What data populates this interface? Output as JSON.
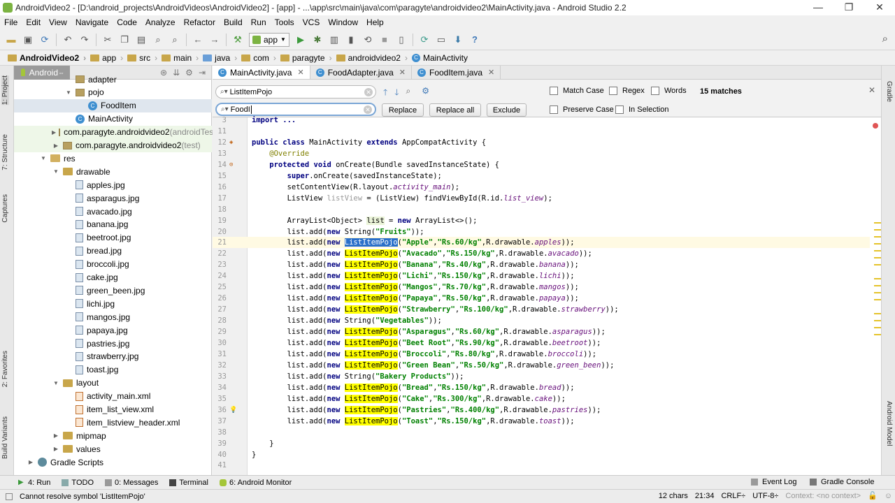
{
  "window": {
    "title": "AndroidVideo2 - [D:\\android_projects\\AndroidVideos\\AndroidVideo2] - [app] - ...\\app\\src\\main\\java\\com\\paragyte\\androidvideo2\\MainActivity.java - Android Studio 2.2",
    "controls": [
      "—",
      "❐",
      "✕"
    ]
  },
  "menu": [
    "File",
    "Edit",
    "View",
    "Navigate",
    "Code",
    "Analyze",
    "Refactor",
    "Build",
    "Run",
    "Tools",
    "VCS",
    "Window",
    "Help"
  ],
  "toolbar": {
    "run_config": "app"
  },
  "breadcrumb": [
    "AndroidVideo2",
    "app",
    "src",
    "main",
    "java",
    "com",
    "paragyte",
    "androidvideo2",
    "MainActivity"
  ],
  "project": {
    "view": "Android",
    "tree": [
      {
        "label": "adapter",
        "indent": 2,
        "icon": "pkg",
        "tw": "",
        "cut": true
      },
      {
        "label": "pojo",
        "indent": 2,
        "icon": "pkg",
        "tw": "▼"
      },
      {
        "label": "FoodItem",
        "indent": 3,
        "icon": "class",
        "tw": "",
        "selected": true
      },
      {
        "label": "MainActivity",
        "indent": 2,
        "icon": "class",
        "tw": ""
      },
      {
        "label": "com.paragyte.androidvideo2",
        "suffix": " (androidTest)",
        "indent": 1,
        "icon": "pkg",
        "tw": "▶",
        "green": true
      },
      {
        "label": "com.paragyte.androidvideo2",
        "suffix": " (test)",
        "indent": 1,
        "icon": "pkg",
        "tw": "▶",
        "green": true
      },
      {
        "label": "res",
        "indent": 0,
        "icon": "res",
        "tw": "▼"
      },
      {
        "label": "drawable",
        "indent": 1,
        "icon": "folder",
        "tw": "▼"
      },
      {
        "label": "apples.jpg",
        "indent": 2,
        "icon": "img",
        "tw": ""
      },
      {
        "label": "asparagus.jpg",
        "indent": 2,
        "icon": "img",
        "tw": ""
      },
      {
        "label": "avacado.jpg",
        "indent": 2,
        "icon": "img",
        "tw": ""
      },
      {
        "label": "banana.jpg",
        "indent": 2,
        "icon": "img",
        "tw": ""
      },
      {
        "label": "beetroot.jpg",
        "indent": 2,
        "icon": "img",
        "tw": ""
      },
      {
        "label": "bread.jpg",
        "indent": 2,
        "icon": "img",
        "tw": ""
      },
      {
        "label": "broccoli.jpg",
        "indent": 2,
        "icon": "img",
        "tw": ""
      },
      {
        "label": "cake.jpg",
        "indent": 2,
        "icon": "img",
        "tw": ""
      },
      {
        "label": "green_been.jpg",
        "indent": 2,
        "icon": "img",
        "tw": ""
      },
      {
        "label": "lichi.jpg",
        "indent": 2,
        "icon": "img",
        "tw": ""
      },
      {
        "label": "mangos.jpg",
        "indent": 2,
        "icon": "img",
        "tw": ""
      },
      {
        "label": "papaya.jpg",
        "indent": 2,
        "icon": "img",
        "tw": ""
      },
      {
        "label": "pastries.jpg",
        "indent": 2,
        "icon": "img",
        "tw": ""
      },
      {
        "label": "strawberry.jpg",
        "indent": 2,
        "icon": "img",
        "tw": ""
      },
      {
        "label": "toast.jpg",
        "indent": 2,
        "icon": "img",
        "tw": ""
      },
      {
        "label": "layout",
        "indent": 1,
        "icon": "folder",
        "tw": "▼"
      },
      {
        "label": "activity_main.xml",
        "indent": 2,
        "icon": "xml",
        "tw": ""
      },
      {
        "label": "item_list_view.xml",
        "indent": 2,
        "icon": "xml",
        "tw": ""
      },
      {
        "label": "item_listview_header.xml",
        "indent": 2,
        "icon": "xml",
        "tw": ""
      },
      {
        "label": "mipmap",
        "indent": 1,
        "icon": "folder",
        "tw": "▶"
      },
      {
        "label": "values",
        "indent": 1,
        "icon": "folder",
        "tw": "▶"
      },
      {
        "label": "Gradle Scripts",
        "indent": -1,
        "icon": "gradle",
        "tw": "▶"
      }
    ]
  },
  "tabs": [
    {
      "label": "MainActivity.java",
      "active": true
    },
    {
      "label": "FoodAdapter.java",
      "active": false
    },
    {
      "label": "FoodItem.java",
      "active": false
    }
  ],
  "find": {
    "search_value": "ListItemPojo",
    "replace_value": "FoodI",
    "replace_label": "Replace",
    "replace_all_label": "Replace all",
    "exclude_label": "Exclude",
    "match_case": "Match Case",
    "regex": "Regex",
    "words": "Words",
    "preserve_case": "Preserve Case",
    "in_selection": "In Selection",
    "matches": "15 matches"
  },
  "code": [
    {
      "n": "3",
      "segs": [
        [
          "import ...",
          "kw"
        ]
      ]
    },
    {
      "n": "11",
      "segs": []
    },
    {
      "n": "12",
      "mark": "class",
      "segs": [
        [
          "public class ",
          "kw"
        ],
        [
          "MainActivity "
        ],
        [
          "extends ",
          "kw"
        ],
        [
          "AppCompatActivity {"
        ]
      ]
    },
    {
      "n": "13",
      "segs": [
        [
          "    @Override",
          "ann"
        ]
      ]
    },
    {
      "n": "14",
      "mark": "override",
      "segs": [
        [
          "    protected void ",
          "kw"
        ],
        [
          "onCreate(Bundle savedInstanceState) {"
        ]
      ]
    },
    {
      "n": "15",
      "segs": [
        [
          "        super",
          "kw"
        ],
        [
          ".onCreate(savedInstanceState);"
        ]
      ]
    },
    {
      "n": "16",
      "segs": [
        [
          "        setContentView(R.layout."
        ],
        [
          "activity_main",
          "fld"
        ],
        [
          ");"
        ]
      ]
    },
    {
      "n": "17",
      "segs": [
        [
          "        ListView "
        ],
        [
          "listView",
          "dim"
        ],
        [
          " = (ListView) findViewById(R.id."
        ],
        [
          "list_view",
          "fld"
        ],
        [
          ");"
        ]
      ]
    },
    {
      "n": "18",
      "segs": []
    },
    {
      "n": "19",
      "segs": [
        [
          "        ArrayList<Object> "
        ],
        [
          "list",
          "fold-hl"
        ],
        [
          " = "
        ],
        [
          "new ",
          "kw"
        ],
        [
          "ArrayList<>();"
        ]
      ]
    },
    {
      "n": "20",
      "segs": [
        [
          "        list.add("
        ],
        [
          "new ",
          "kw"
        ],
        [
          "String("
        ],
        [
          "\"Fruits\"",
          "str"
        ],
        [
          "));"
        ]
      ]
    },
    {
      "n": "21",
      "current": true,
      "segs": [
        [
          "        list.add("
        ],
        [
          "new ",
          "kw"
        ],
        [
          "ListItemPojo",
          "hl sel"
        ],
        [
          "("
        ],
        [
          "\"Apple\"",
          "str"
        ],
        [
          ","
        ],
        [
          "\"Rs.60/kg\"",
          "str"
        ],
        [
          ",R.drawable."
        ],
        [
          "apples",
          "fld"
        ],
        [
          "));"
        ]
      ]
    },
    {
      "n": "22",
      "segs": [
        [
          "        list.add("
        ],
        [
          "new ",
          "kw"
        ],
        [
          "ListItemPojo",
          "hl"
        ],
        [
          "("
        ],
        [
          "\"Avacado\"",
          "str"
        ],
        [
          ","
        ],
        [
          "\"Rs.150/kg\"",
          "str"
        ],
        [
          ",R.drawable."
        ],
        [
          "avacado",
          "fld"
        ],
        [
          "));"
        ]
      ]
    },
    {
      "n": "23",
      "segs": [
        [
          "        list.add("
        ],
        [
          "new ",
          "kw"
        ],
        [
          "ListItemPojo",
          "hl"
        ],
        [
          "("
        ],
        [
          "\"Banana\"",
          "str"
        ],
        [
          ","
        ],
        [
          "\"Rs.40/kg\"",
          "str"
        ],
        [
          ",R.drawable."
        ],
        [
          "banana",
          "fld"
        ],
        [
          "));"
        ]
      ]
    },
    {
      "n": "24",
      "segs": [
        [
          "        list.add("
        ],
        [
          "new ",
          "kw"
        ],
        [
          "ListItemPojo",
          "hl"
        ],
        [
          "("
        ],
        [
          "\"Lichi\"",
          "str"
        ],
        [
          ","
        ],
        [
          "\"Rs.150/kg\"",
          "str"
        ],
        [
          ",R.drawable."
        ],
        [
          "lichi",
          "fld"
        ],
        [
          "));"
        ]
      ]
    },
    {
      "n": "25",
      "segs": [
        [
          "        list.add("
        ],
        [
          "new ",
          "kw"
        ],
        [
          "ListItemPojo",
          "hl"
        ],
        [
          "("
        ],
        [
          "\"Mangos\"",
          "str"
        ],
        [
          ","
        ],
        [
          "\"Rs.70/kg\"",
          "str"
        ],
        [
          ",R.drawable."
        ],
        [
          "mangos",
          "fld"
        ],
        [
          "));"
        ]
      ]
    },
    {
      "n": "26",
      "segs": [
        [
          "        list.add("
        ],
        [
          "new ",
          "kw"
        ],
        [
          "ListItemPojo",
          "hl"
        ],
        [
          "("
        ],
        [
          "\"Papaya\"",
          "str"
        ],
        [
          ","
        ],
        [
          "\"Rs.50/kg\"",
          "str"
        ],
        [
          ",R.drawable."
        ],
        [
          "papaya",
          "fld"
        ],
        [
          "));"
        ]
      ]
    },
    {
      "n": "27",
      "segs": [
        [
          "        list.add("
        ],
        [
          "new ",
          "kw"
        ],
        [
          "ListItemPojo",
          "hl"
        ],
        [
          "("
        ],
        [
          "\"Strawberry\"",
          "str"
        ],
        [
          ","
        ],
        [
          "\"Rs.100/kg\"",
          "str"
        ],
        [
          ",R.drawable."
        ],
        [
          "strawberry",
          "fld"
        ],
        [
          "));"
        ]
      ]
    },
    {
      "n": "28",
      "segs": [
        [
          "        list.add("
        ],
        [
          "new ",
          "kw"
        ],
        [
          "String("
        ],
        [
          "\"Vegetables\"",
          "str"
        ],
        [
          "));"
        ]
      ]
    },
    {
      "n": "29",
      "segs": [
        [
          "        list.add("
        ],
        [
          "new ",
          "kw"
        ],
        [
          "ListItemPojo",
          "hl"
        ],
        [
          "("
        ],
        [
          "\"Asparagus\"",
          "str"
        ],
        [
          ","
        ],
        [
          "\"Rs.60/kg\"",
          "str"
        ],
        [
          ",R.drawable."
        ],
        [
          "asparagus",
          "fld"
        ],
        [
          "));"
        ]
      ]
    },
    {
      "n": "30",
      "segs": [
        [
          "        list.add("
        ],
        [
          "new ",
          "kw"
        ],
        [
          "ListItemPojo",
          "hl"
        ],
        [
          "("
        ],
        [
          "\"Beet Root\"",
          "str"
        ],
        [
          ","
        ],
        [
          "\"Rs.90/kg\"",
          "str"
        ],
        [
          ",R.drawable."
        ],
        [
          "beetroot",
          "fld"
        ],
        [
          "));"
        ]
      ]
    },
    {
      "n": "31",
      "segs": [
        [
          "        list.add("
        ],
        [
          "new ",
          "kw"
        ],
        [
          "ListItemPojo",
          "hl"
        ],
        [
          "("
        ],
        [
          "\"Broccoli\"",
          "str"
        ],
        [
          ","
        ],
        [
          "\"Rs.80/kg\"",
          "str"
        ],
        [
          ",R.drawable."
        ],
        [
          "broccoli",
          "fld"
        ],
        [
          "));"
        ]
      ]
    },
    {
      "n": "32",
      "segs": [
        [
          "        list.add("
        ],
        [
          "new ",
          "kw"
        ],
        [
          "ListItemPojo",
          "hl"
        ],
        [
          "("
        ],
        [
          "\"Green Bean\"",
          "str"
        ],
        [
          ","
        ],
        [
          "\"Rs.50/kg\"",
          "str"
        ],
        [
          ",R.drawable."
        ],
        [
          "green_been",
          "fld"
        ],
        [
          "));"
        ]
      ]
    },
    {
      "n": "33",
      "segs": [
        [
          "        list.add("
        ],
        [
          "new ",
          "kw"
        ],
        [
          "String("
        ],
        [
          "\"Bakery Products\"",
          "str"
        ],
        [
          "));"
        ]
      ]
    },
    {
      "n": "34",
      "segs": [
        [
          "        list.add("
        ],
        [
          "new ",
          "kw"
        ],
        [
          "ListItemPojo",
          "hl"
        ],
        [
          "("
        ],
        [
          "\"Bread\"",
          "str"
        ],
        [
          ","
        ],
        [
          "\"Rs.150/kg\"",
          "str"
        ],
        [
          ",R.drawable."
        ],
        [
          "bread",
          "fld"
        ],
        [
          "));"
        ]
      ]
    },
    {
      "n": "35",
      "segs": [
        [
          "        list.add("
        ],
        [
          "new ",
          "kw"
        ],
        [
          "ListItemPojo",
          "hl"
        ],
        [
          "("
        ],
        [
          "\"Cake\"",
          "str"
        ],
        [
          ","
        ],
        [
          "\"Rs.300/kg\"",
          "str"
        ],
        [
          ",R.drawable."
        ],
        [
          "cake",
          "fld"
        ],
        [
          "));"
        ]
      ]
    },
    {
      "n": "36",
      "mark": "bulb",
      "segs": [
        [
          "        list.add("
        ],
        [
          "new ",
          "kw"
        ],
        [
          "ListItemPojo",
          "hl"
        ],
        [
          "("
        ],
        [
          "\"Pastries\"",
          "str"
        ],
        [
          ","
        ],
        [
          "\"Rs.400/kg\"",
          "str"
        ],
        [
          ",R.drawable."
        ],
        [
          "pastries",
          "fld"
        ],
        [
          "));"
        ]
      ]
    },
    {
      "n": "37",
      "segs": [
        [
          "        list.add("
        ],
        [
          "new ",
          "kw"
        ],
        [
          "ListItemPojo",
          "hl"
        ],
        [
          "("
        ],
        [
          "\"Toast\"",
          "str"
        ],
        [
          ","
        ],
        [
          "\"Rs.150/kg\"",
          "str"
        ],
        [
          ",R.drawable."
        ],
        [
          "toast",
          "fld"
        ],
        [
          "));"
        ]
      ]
    },
    {
      "n": "38",
      "segs": []
    },
    {
      "n": "39",
      "segs": [
        [
          "    }"
        ]
      ]
    },
    {
      "n": "40",
      "segs": [
        [
          "}"
        ]
      ]
    },
    {
      "n": "41",
      "segs": []
    }
  ],
  "bottom_tools": {
    "run": "4: Run",
    "todo": "TODO",
    "messages": "0: Messages",
    "terminal": "Terminal",
    "monitor": "6: Android Monitor",
    "event_log": "Event Log",
    "gradle_console": "Gradle Console"
  },
  "side_tabs": {
    "project": "1: Project",
    "structure": "7: Structure",
    "captures": "Captures",
    "favorites": "2: Favorites",
    "build_variants": "Build Variants",
    "gradle": "Gradle",
    "android_model": "Android Model"
  },
  "status": {
    "message": "Cannot resolve symbol 'ListItemPojo'",
    "chars": "12 chars",
    "position": "21:34",
    "line_sep": "CRLF÷",
    "encoding": "UTF-8÷",
    "context": "Context: <no context>"
  }
}
